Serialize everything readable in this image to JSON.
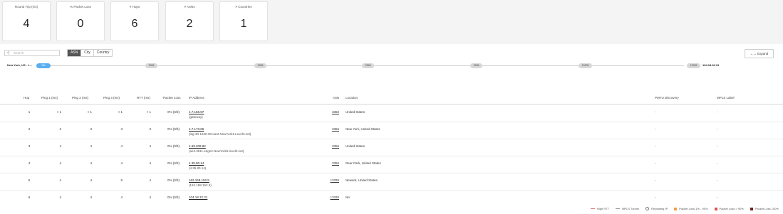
{
  "summary": [
    {
      "label": "Round Trip (ms)",
      "value": "4"
    },
    {
      "label": "% Packet Loss",
      "value": "0"
    },
    {
      "label": "# Hops",
      "value": "6"
    },
    {
      "label": "# ASNs",
      "value": "2"
    },
    {
      "label": "# Countries",
      "value": "1"
    }
  ],
  "search": {
    "placeholder": "Search"
  },
  "group_by": {
    "options": [
      "ASN",
      "City",
      "Country"
    ],
    "selected": "ASN"
  },
  "expand_label": "←→ Expand",
  "path": {
    "origin": "New York, US - L...",
    "destination": "104.18.32.31",
    "nodes": [
      "NA",
      "3356",
      "3356",
      "3356",
      "3356",
      "13335",
      "13335"
    ]
  },
  "table": {
    "headers": {
      "hop": "Hop",
      "ping1": "Ping 1 (ms)",
      "ping2": "Ping 2 (ms)",
      "ping3": "Ping 3 (ms)",
      "rtt": "RTT (ms)",
      "loss": "Packet Loss",
      "ip": "IP Address",
      "asn": "ASN",
      "location": "Location",
      "pmtu": "PMTU Discovery",
      "mpls": "MPLS Label"
    },
    "rows": [
      {
        "hop": "1",
        "ping1": "< 1",
        "ping2": "< 1",
        "ping3": "< 1",
        "rtt": "< 1",
        "loss": "0% (0/3)",
        "ip": "4.7.166.97",
        "host": "(gateway)",
        "asn": "3356",
        "location": "United States",
        "pmtu": "-",
        "mpls": "-"
      },
      {
        "hop": "2",
        "ping1": "3",
        "ping2": "3",
        "ping3": "3",
        "rtt": "3",
        "loss": "0% (0/3)",
        "ip": "4.7.173.65",
        "host": "(lag-30-1620-90.ear2.NewYork1.Level3.net)",
        "asn": "3356",
        "location": "New York, United States",
        "pmtu": "-",
        "mpls": "-"
      },
      {
        "hop": "3",
        "ping1": "4",
        "ping2": "4",
        "ping3": "4",
        "rtt": "4",
        "loss": "0% (0/3)",
        "ip": "4.69.209.82",
        "host": "(ae2.3611.edge2.NewYork6.level3.net)",
        "asn": "3356",
        "location": "United States",
        "pmtu": "-",
        "mpls": "-"
      },
      {
        "hop": "4",
        "ping1": "4",
        "ping2": "4",
        "ping3": "4",
        "rtt": "4",
        "loss": "0% (0/3)",
        "ip": "4.35.80.14",
        "host": "(4.35.80.14)",
        "asn": "3356",
        "location": "Deer Park, United States",
        "pmtu": "-",
        "mpls": "-"
      },
      {
        "hop": "5",
        "ping1": "4",
        "ping2": "4",
        "ping3": "5",
        "rtt": "4",
        "loss": "0% (0/3)",
        "ip": "162.158.152.5",
        "host": "(162.158.152.5)",
        "asn": "13335",
        "location": "Newark, United States",
        "pmtu": "-",
        "mpls": "-"
      },
      {
        "hop": "6",
        "ping1": "4",
        "ping2": "4",
        "ping3": "4",
        "rtt": "4",
        "loss": "0% (0/3)",
        "ip": "104.18.32.31",
        "host": "",
        "asn": "13335",
        "location": "NA",
        "pmtu": "-",
        "mpls": "-"
      }
    ]
  },
  "legend": [
    {
      "label": "High RTT",
      "kind": "line",
      "color": "#e07a7a"
    },
    {
      "label": "MPLS Tunnel",
      "kind": "dashed",
      "color": "#999999"
    },
    {
      "label": "Repeating IP",
      "kind": "icon",
      "color": "#777777"
    },
    {
      "label": "Packet Loss 1% - 90%",
      "kind": "box",
      "color": "#f0a04b"
    },
    {
      "label": "Packet Loss > 90%",
      "kind": "box",
      "color": "#d9534f"
    },
    {
      "label": "Packet Loss 100%",
      "kind": "box",
      "color": "#7a1f1f"
    }
  ]
}
